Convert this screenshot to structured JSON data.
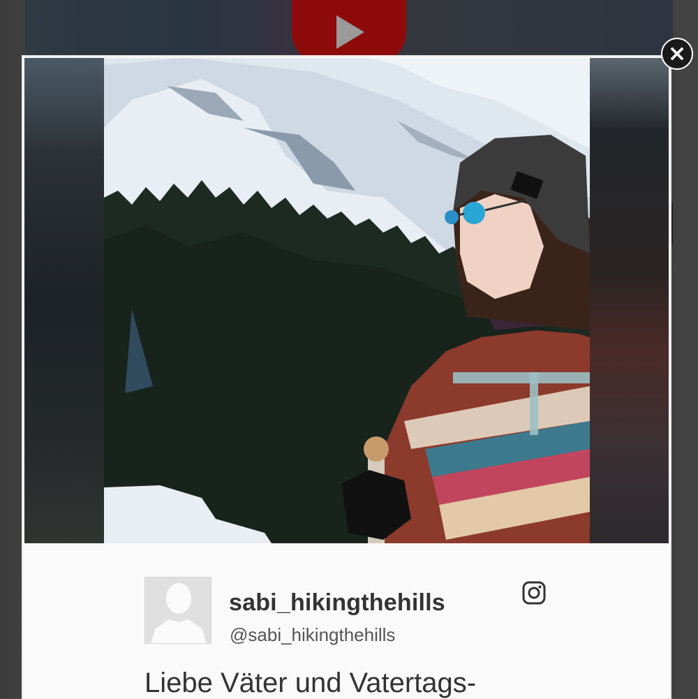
{
  "overlay": {
    "close_label": "×"
  },
  "post": {
    "username": "sabi_hikingthehills",
    "handle": "@sabi_hikingthehills",
    "caption": "Liebe Väter und Vatertags-"
  },
  "icons": {
    "close": "close-icon",
    "instagram": "instagram-icon",
    "avatar": "default-avatar-icon",
    "youtube": "youtube-play-icon"
  },
  "colors": {
    "overlay_bg": "#4a4a4a",
    "panel_bg": "#fafafa",
    "username": "#333333",
    "youtube_red": "#8e0b0b"
  }
}
